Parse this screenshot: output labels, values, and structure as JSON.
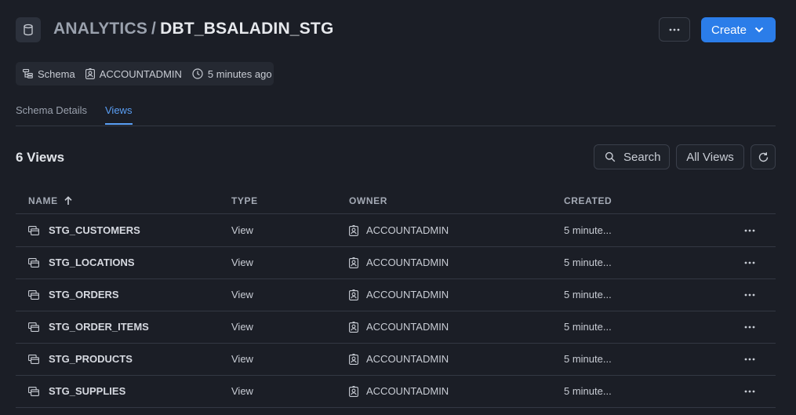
{
  "header": {
    "breadcrumb_parent": "ANALYTICS",
    "breadcrumb_sep": "/",
    "title": "DBT_BSALADIN_STG",
    "create_label": "Create",
    "icons": {
      "db": "database-icon",
      "more": "ellipsis-icon",
      "create_caret": "chevron-down-icon"
    }
  },
  "meta": {
    "type": "Schema",
    "owner": "ACCOUNTADMIN",
    "updated": "5 minutes ago"
  },
  "tabs": [
    {
      "label": "Schema Details",
      "active": false
    },
    {
      "label": "Views",
      "active": true
    }
  ],
  "list": {
    "count_label": "6 Views",
    "search_label": "Search",
    "filter_label": "All Views"
  },
  "table": {
    "columns": [
      "NAME",
      "TYPE",
      "OWNER",
      "CREATED"
    ],
    "sort": {
      "column": "NAME",
      "direction": "ascending"
    },
    "rows": [
      {
        "name": "STG_CUSTOMERS",
        "type": "View",
        "owner": "ACCOUNTADMIN",
        "created": "5 minute..."
      },
      {
        "name": "STG_LOCATIONS",
        "type": "View",
        "owner": "ACCOUNTADMIN",
        "created": "5 minute..."
      },
      {
        "name": "STG_ORDERS",
        "type": "View",
        "owner": "ACCOUNTADMIN",
        "created": "5 minute..."
      },
      {
        "name": "STG_ORDER_ITEMS",
        "type": "View",
        "owner": "ACCOUNTADMIN",
        "created": "5 minute..."
      },
      {
        "name": "STG_PRODUCTS",
        "type": "View",
        "owner": "ACCOUNTADMIN",
        "created": "5 minute..."
      },
      {
        "name": "STG_SUPPLIES",
        "type": "View",
        "owner": "ACCOUNTADMIN",
        "created": "5 minute..."
      }
    ]
  },
  "colors": {
    "background": "#1b1e26",
    "accent": "#2b7de9",
    "active_tab": "#5a9ff5"
  }
}
